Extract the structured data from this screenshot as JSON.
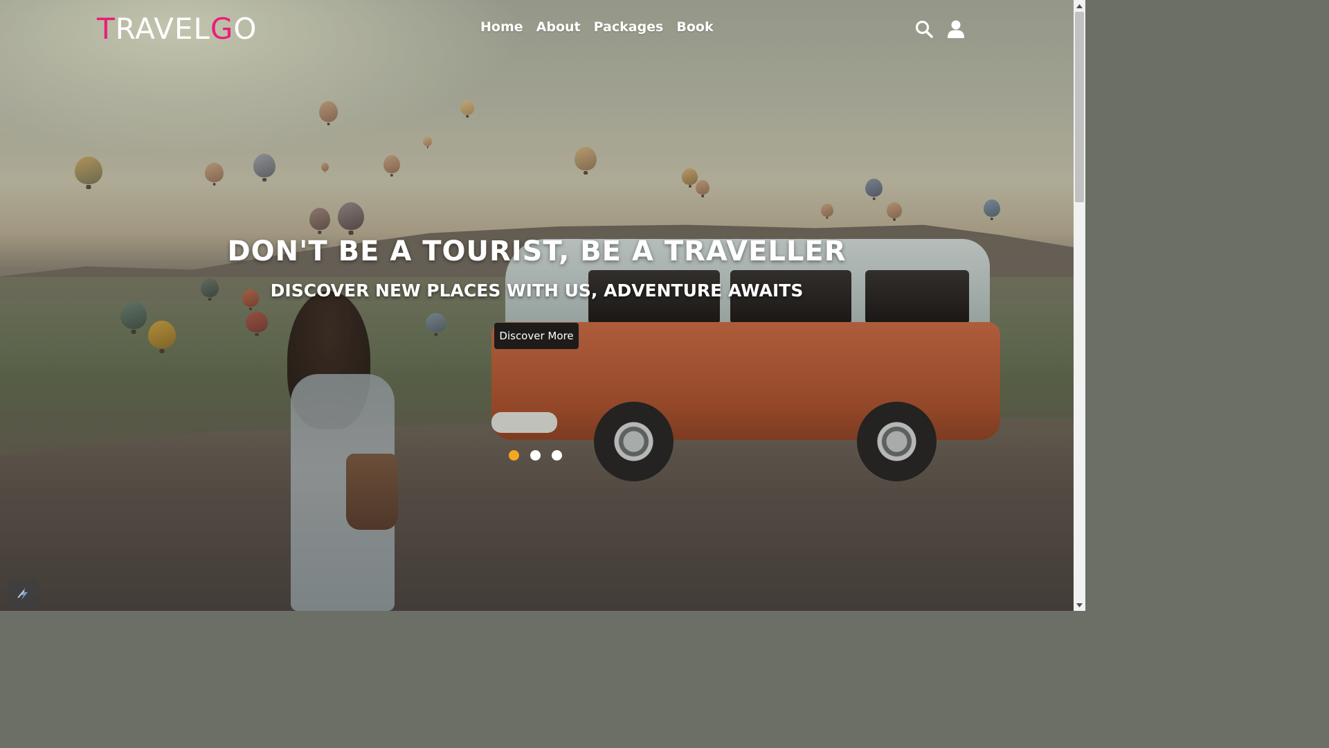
{
  "logo": {
    "first_letter": "T",
    "mid_text": "RAVEL",
    "accent_letter": "G",
    "end_text": "O",
    "accent_color": "#e91e7a"
  },
  "nav": {
    "links": [
      {
        "label": "Home"
      },
      {
        "label": "About"
      },
      {
        "label": "Packages"
      },
      {
        "label": "Book"
      }
    ],
    "icons": [
      "search-icon",
      "user-icon"
    ]
  },
  "hero": {
    "title": "DON'T BE A TOURIST, BE A TRAVELLER",
    "subtitle": "DISCOVER NEW PLACES WITH US, ADVENTURE AWAITS",
    "cta_label": "Discover More"
  },
  "carousel": {
    "slide_count": 3,
    "active_index": 0,
    "active_color": "#f5a623",
    "inactive_color": "#ffffff"
  },
  "colors": {
    "button_bg": "#1d1c1b",
    "text": "#ffffff"
  }
}
